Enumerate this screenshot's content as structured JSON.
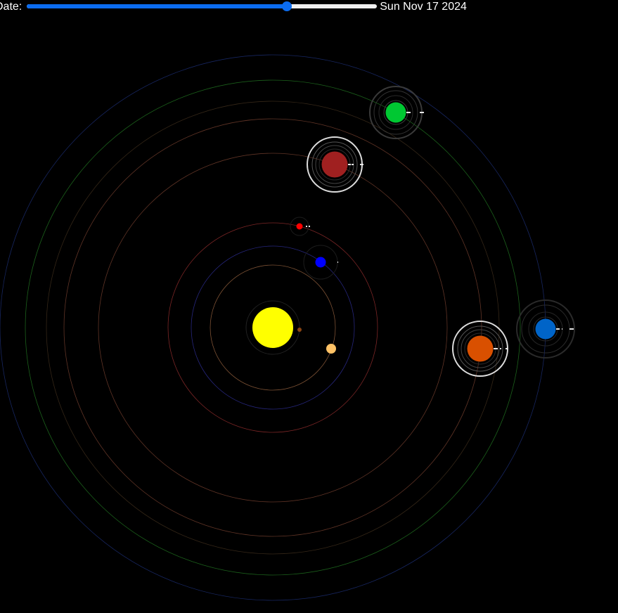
{
  "controls": {
    "date_label": "Date:",
    "date_value": "Sun Nov 17 2024",
    "slider_position": 0.7415,
    "slider_fill_color": "#0b6cf0"
  },
  "scene": {
    "background": "#000000",
    "sun": {
      "name": "sun",
      "color": "#ffff00"
    },
    "orbits": [
      {
        "name": "orbit-1",
        "color": "#8a5a3a"
      },
      {
        "name": "orbit-2",
        "color": "#2a2a8a"
      },
      {
        "name": "orbit-3",
        "color": "#8a2a2a"
      },
      {
        "name": "orbit-4",
        "color": "#6a3a2a"
      },
      {
        "name": "orbit-5",
        "color": "#6a3a2a"
      },
      {
        "name": "orbit-6",
        "color": "#3a2a1a"
      },
      {
        "name": "orbit-7",
        "color": "#1e6a1e"
      },
      {
        "name": "orbit-8",
        "color": "#1a2a6a"
      }
    ],
    "planets": [
      {
        "name": "planet-mercury",
        "color": "#8b4513"
      },
      {
        "name": "planet-venus",
        "color": "#ffc266"
      },
      {
        "name": "planet-earth",
        "color": "#0000ff"
      },
      {
        "name": "planet-mars",
        "color": "#ff0000"
      },
      {
        "name": "planet-jupiter",
        "color": "#a02020"
      },
      {
        "name": "planet-saturn",
        "color": "#d95000"
      },
      {
        "name": "planet-uranus",
        "color": "#00c832"
      },
      {
        "name": "planet-neptune",
        "color": "#0064c8"
      }
    ]
  }
}
